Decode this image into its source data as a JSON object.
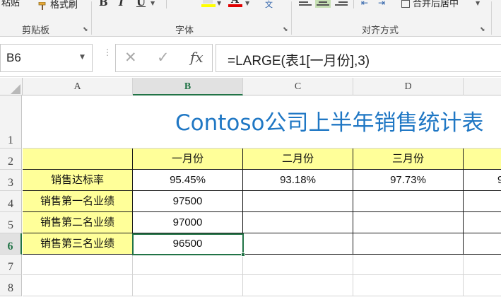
{
  "ribbon": {
    "clipboard": {
      "paste_label": "粘贴",
      "format_painter_label": "格式刷",
      "group_label": "剪贴板"
    },
    "font": {
      "bold": "B",
      "italic": "I",
      "underline": "U",
      "group_label": "字体",
      "phonetic_glyph": "文"
    },
    "alignment": {
      "merge_label": "合并后居中",
      "group_label": "对齐方式"
    }
  },
  "formula_bar": {
    "name_box": "B6",
    "cancel_glyph": "✕",
    "enter_glyph": "✓",
    "fx_label": "fx",
    "formula": "=LARGE(表1[一月份],3)"
  },
  "columns": [
    "A",
    "B",
    "C",
    "D",
    ""
  ],
  "rows": [
    "1",
    "2",
    "3",
    "4",
    "5",
    "6",
    "7",
    "8"
  ],
  "sheet": {
    "title": "Contoso公司上半年销售统计表",
    "headers": [
      "",
      "一月份",
      "二月份",
      "三月份",
      ""
    ],
    "row3": {
      "label": "销售达标率",
      "values": [
        "95.45%",
        "93.18%",
        "97.73%",
        "9"
      ]
    },
    "row4": {
      "label": "销售第一名业绩",
      "values": [
        "97500",
        "",
        "",
        ""
      ]
    },
    "row5": {
      "label": "销售第二名业绩",
      "values": [
        "97000",
        "",
        "",
        ""
      ]
    },
    "row6": {
      "label": "销售第三名业绩",
      "values": [
        "96500",
        "",
        "",
        ""
      ]
    }
  },
  "colors": {
    "accent": "#217346",
    "title": "#1f77c4",
    "highlight": "#ffff99"
  }
}
